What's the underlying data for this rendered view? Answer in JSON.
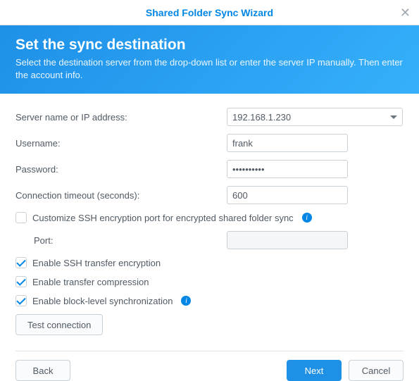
{
  "window": {
    "title": "Shared Folder Sync Wizard"
  },
  "banner": {
    "heading": "Set the sync destination",
    "subtext": "Select the destination server from the drop-down list or enter the server IP manually. Then enter the account info."
  },
  "form": {
    "server_label": "Server name or IP address:",
    "server_value": "192.168.1.230",
    "username_label": "Username:",
    "username_value": "frank",
    "password_label": "Password:",
    "password_value": "••••••••••",
    "timeout_label": "Connection timeout (seconds):",
    "timeout_value": "600",
    "customize_ssh_port_label": "Customize SSH encryption port for encrypted shared folder sync",
    "customize_ssh_port_checked": false,
    "port_label": "Port:",
    "port_value": "",
    "enable_ssh_enc_label": "Enable SSH transfer encryption",
    "enable_ssh_enc_checked": true,
    "enable_compress_label": "Enable transfer compression",
    "enable_compress_checked": true,
    "enable_block_label": "Enable block-level synchronization",
    "enable_block_checked": true,
    "test_btn": "Test connection"
  },
  "footer": {
    "back": "Back",
    "next": "Next",
    "cancel": "Cancel"
  }
}
